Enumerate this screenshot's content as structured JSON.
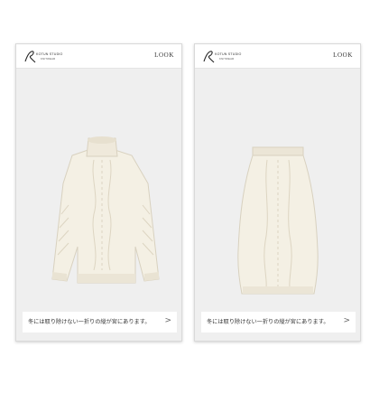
{
  "screens": [
    {
      "brand_line1": "KOTUN STUDIO",
      "brand_line2": "KNITWEAR",
      "look_label": "LOOK",
      "product_icon": "cable-knit-turtleneck-sweater",
      "caption": "冬には取り除けない一折りの縦が宮にあります。",
      "arrow_icon": "chevron-right-icon"
    },
    {
      "brand_line1": "KOTUN STUDIO",
      "brand_line2": "KNITWEAR",
      "look_label": "LOOK",
      "product_icon": "cable-knit-pencil-skirt",
      "caption": "冬には取り除けない一折りの縦が宮にあります。",
      "arrow_icon": "chevron-right-icon"
    }
  ],
  "colors": {
    "background": "#efefef",
    "knit": "#f3efe3",
    "knit_shade": "#ddd6c4"
  }
}
